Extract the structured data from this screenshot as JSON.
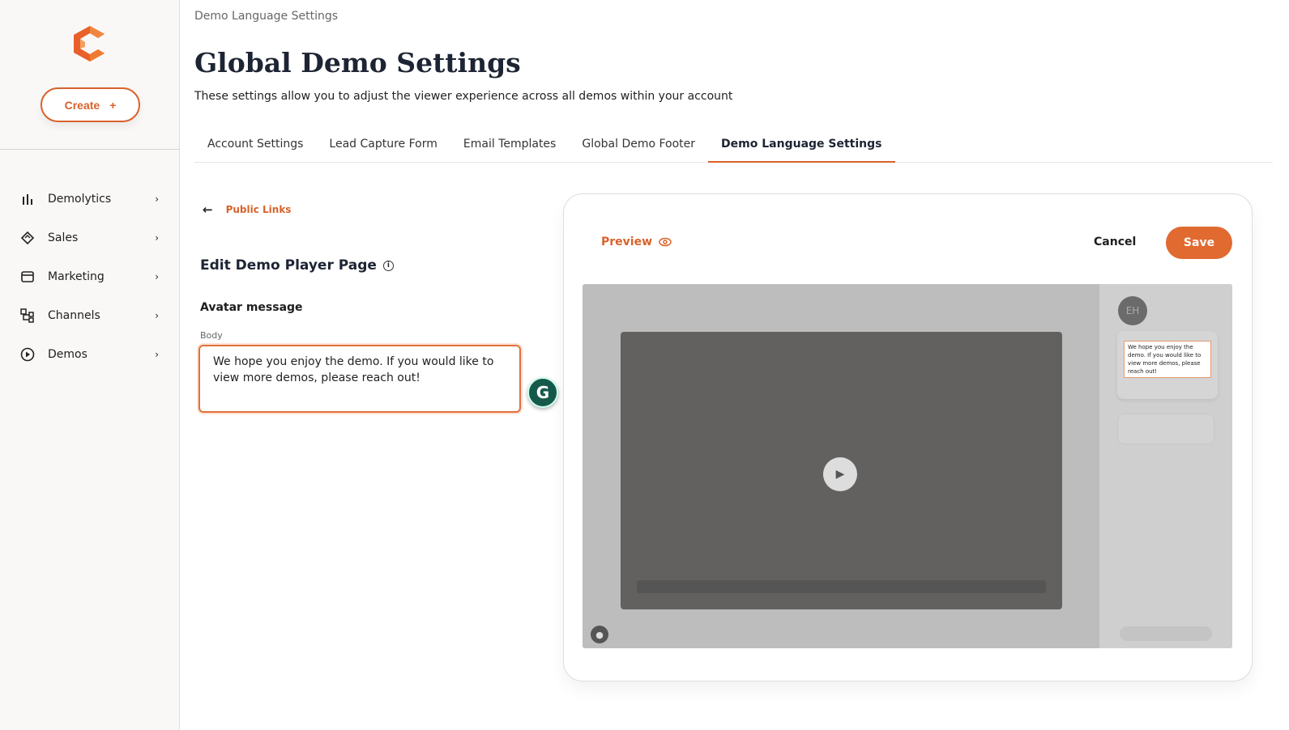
{
  "brand": {
    "accent": "#d9622b"
  },
  "sidebar": {
    "create_label": "Create",
    "create_icon": "+",
    "items": [
      {
        "label": "Demolytics",
        "icon": "bar-chart-icon"
      },
      {
        "label": "Sales",
        "icon": "handshake-icon"
      },
      {
        "label": "Marketing",
        "icon": "storefront-icon"
      },
      {
        "label": "Channels",
        "icon": "channels-icon"
      },
      {
        "label": "Demos",
        "icon": "play-circle-icon"
      }
    ]
  },
  "header": {
    "breadcrumb": "Demo Language Settings",
    "title": "Global Demo Settings",
    "subtitle": "These settings allow you to adjust the viewer experience across all demos within your account"
  },
  "tabs": [
    "Account Settings",
    "Lead Capture Form",
    "Email Templates",
    "Global Demo Footer",
    "Demo Language Settings"
  ],
  "form": {
    "back_label": "Public Links",
    "heading": "Edit Demo Player Page",
    "section": "Avatar message",
    "body_label": "Body",
    "body_value": "We hope you enjoy the demo. If you would like to view more demos, please reach out!"
  },
  "preview": {
    "label": "Preview",
    "cancel": "Cancel",
    "save": "Save",
    "avatar_initials": "EH",
    "message": "We hope you enjoy the demo. If you would like to view more demos, please reach out!"
  }
}
